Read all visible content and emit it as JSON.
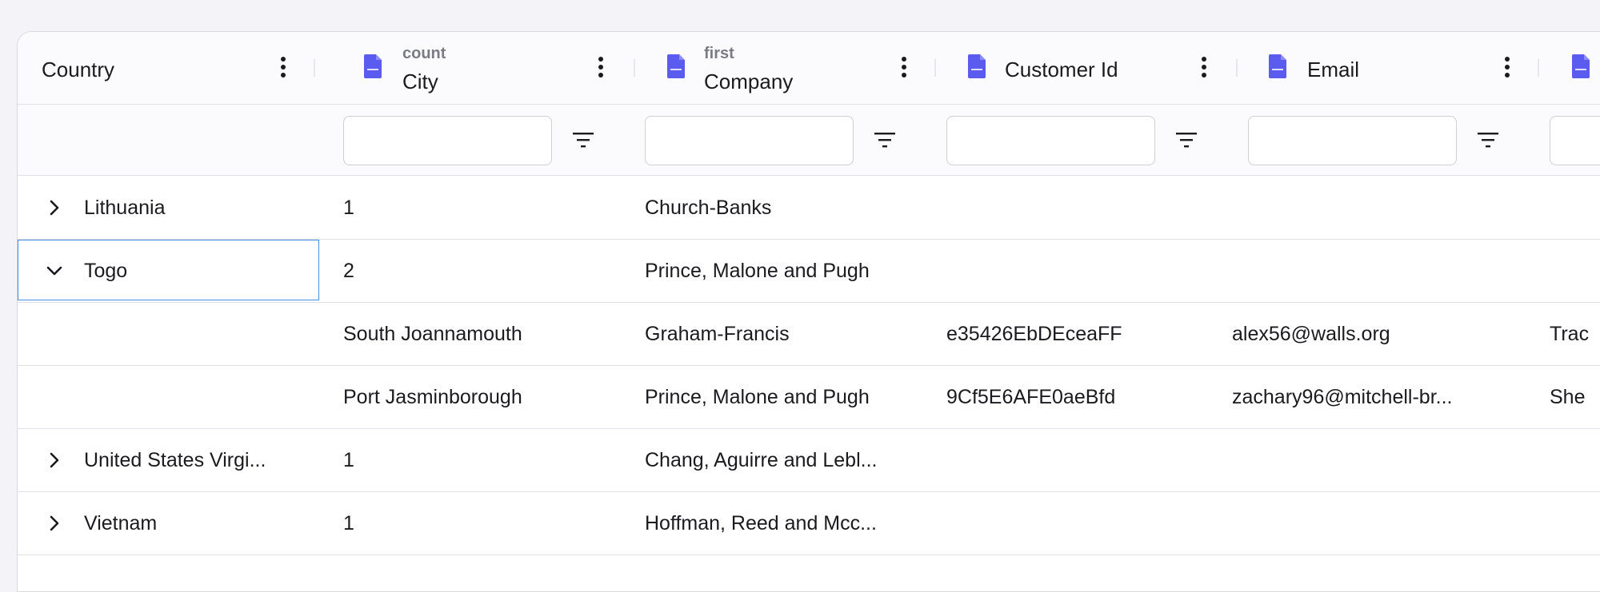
{
  "colors": {
    "accent": "#5b5bf0",
    "focus": "#4a90e2",
    "border": "#e0e0e6"
  },
  "columns": [
    {
      "id": "country",
      "label": "Country",
      "sub": "",
      "icon": ""
    },
    {
      "id": "city",
      "label": "City",
      "sub": "count",
      "icon": "file-icon"
    },
    {
      "id": "company",
      "label": "Company",
      "sub": "first",
      "icon": "file-icon"
    },
    {
      "id": "customer_id",
      "label": "Customer Id",
      "sub": "",
      "icon": "file-icon"
    },
    {
      "id": "email",
      "label": "Email",
      "sub": "",
      "icon": "file-icon"
    },
    {
      "id": "extra",
      "label": "",
      "sub": "",
      "icon": "file-icon"
    }
  ],
  "filters": {
    "city": "",
    "company": "",
    "customer_id": "",
    "email": "",
    "extra": ""
  },
  "rows": [
    {
      "type": "group",
      "expanded": false,
      "country": "Lithuania",
      "city": "1",
      "company": "Church-Banks"
    },
    {
      "type": "group",
      "expanded": true,
      "focused": true,
      "country": "Togo",
      "city": "2",
      "company": "Prince, Malone and Pugh"
    },
    {
      "type": "detail",
      "city": "South Joannamouth",
      "company": "Graham-Francis",
      "customer_id": "e35426EbDEceaFF",
      "email": "alex56@walls.org",
      "extra": "Trac"
    },
    {
      "type": "detail",
      "city": "Port Jasminborough",
      "company": "Prince, Malone and Pugh",
      "customer_id": "9Cf5E6AFE0aeBfd",
      "email": "zachary96@mitchell-br...",
      "extra": "She"
    },
    {
      "type": "group",
      "expanded": false,
      "country": "United States Virgi...",
      "city": "1",
      "company": "Chang, Aguirre and Lebl..."
    },
    {
      "type": "group",
      "expanded": false,
      "country": "Vietnam",
      "city": "1",
      "company": "Hoffman, Reed and Mcc..."
    }
  ]
}
